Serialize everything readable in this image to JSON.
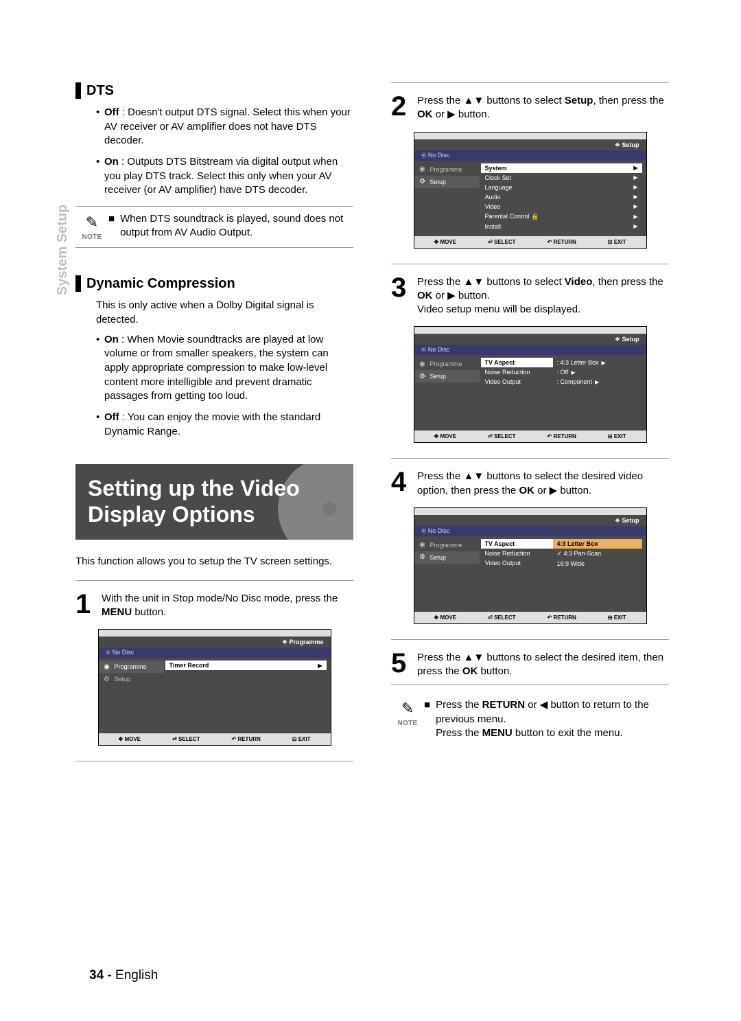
{
  "sideTab": "System Setup",
  "page": {
    "number": "34 -",
    "lang": "English"
  },
  "left": {
    "dts": {
      "title": "DTS",
      "off": {
        "label": "Off",
        "text": " : Doesn't output DTS signal. Select this when your AV receiver or AV amplifier does not have DTS decoder."
      },
      "on": {
        "label": "On",
        "text": " : Outputs DTS Bitstream via digital output when you play DTS track. Select this only when your AV receiver (or AV amplifier) have DTS decoder."
      },
      "note": {
        "label": "NOTE",
        "text": "When DTS soundtrack is played, sound does not output from AV Audio Output."
      }
    },
    "dyn": {
      "title": "Dynamic Compression",
      "intro": "This is only active when a Dolby Digital signal is detected.",
      "on": {
        "label": "On",
        "text": " : When Movie soundtracks are played at low volume or from smaller speakers, the system can apply appropriate compression to make low-level content more intelligible and prevent dramatic passages from getting too loud."
      },
      "off": {
        "label": "Off",
        "text": " : You can enjoy the movie with the standard Dynamic Range."
      }
    },
    "bigTitle": "Setting up the Video Display Options",
    "intro2": "This function allows you to setup the TV screen settings.",
    "step1": {
      "pre": "With the unit in Stop mode/No Disc mode, press the ",
      "btn": "MENU",
      "post": " button."
    }
  },
  "right": {
    "step2": {
      "a": "Press the ▲▼ buttons to select ",
      "b": "Setup",
      "c": ", then press the ",
      "d": "OK",
      "e": " or ▶ button."
    },
    "step3": {
      "a": "Press the ▲▼ buttons to select ",
      "b": "Video",
      "c": ", then press the ",
      "d": "OK",
      "e": " or ▶ button.",
      "f": "Video setup menu will be displayed."
    },
    "step4": {
      "a": "Press the ▲▼ buttons to select the desired video option, then press the ",
      "b": "OK",
      "c": " or ▶ button."
    },
    "step5": {
      "a": "Press the ▲▼ buttons to select the desired item, then press the ",
      "b": "OK",
      "c": " button."
    },
    "note": {
      "label": "NOTE",
      "a": "Press the ",
      "b": "RETURN",
      "c": " or ◀ button to return to the previous menu.",
      "d": "Press the ",
      "e": "MENU",
      "f": " button to exit the menu."
    }
  },
  "osdCommon": {
    "status": "No Disc",
    "legend": {
      "move": "MOVE",
      "select": "SELECT",
      "return": "RETURN",
      "exit": "EXIT"
    },
    "sidebar": {
      "programme": "Programme",
      "setup": "Setup"
    }
  },
  "osd1": {
    "crumb": "Programme",
    "row": "Timer Record"
  },
  "osd2": {
    "crumb": "Setup",
    "rows": [
      "System",
      "Clock Set",
      "Language",
      "Audio",
      "Video",
      "Parental Control",
      "Install"
    ],
    "lockIdx": 5
  },
  "osd3": {
    "crumb": "Setup",
    "labels": [
      "TV Aspect",
      "Noise Reduction",
      "Video Output"
    ],
    "values": [
      ": 4:3 Letter Box",
      ": Off",
      ": Component"
    ]
  },
  "osd4": {
    "crumb": "Setup",
    "labels": [
      "TV Aspect",
      "Noise Reduction",
      "Video Output"
    ],
    "options": [
      "4:3 Letter Box",
      "4:3 Pan-Scan",
      "16:9 Wide"
    ],
    "checkIdx": 1,
    "hiIdx": 0
  }
}
